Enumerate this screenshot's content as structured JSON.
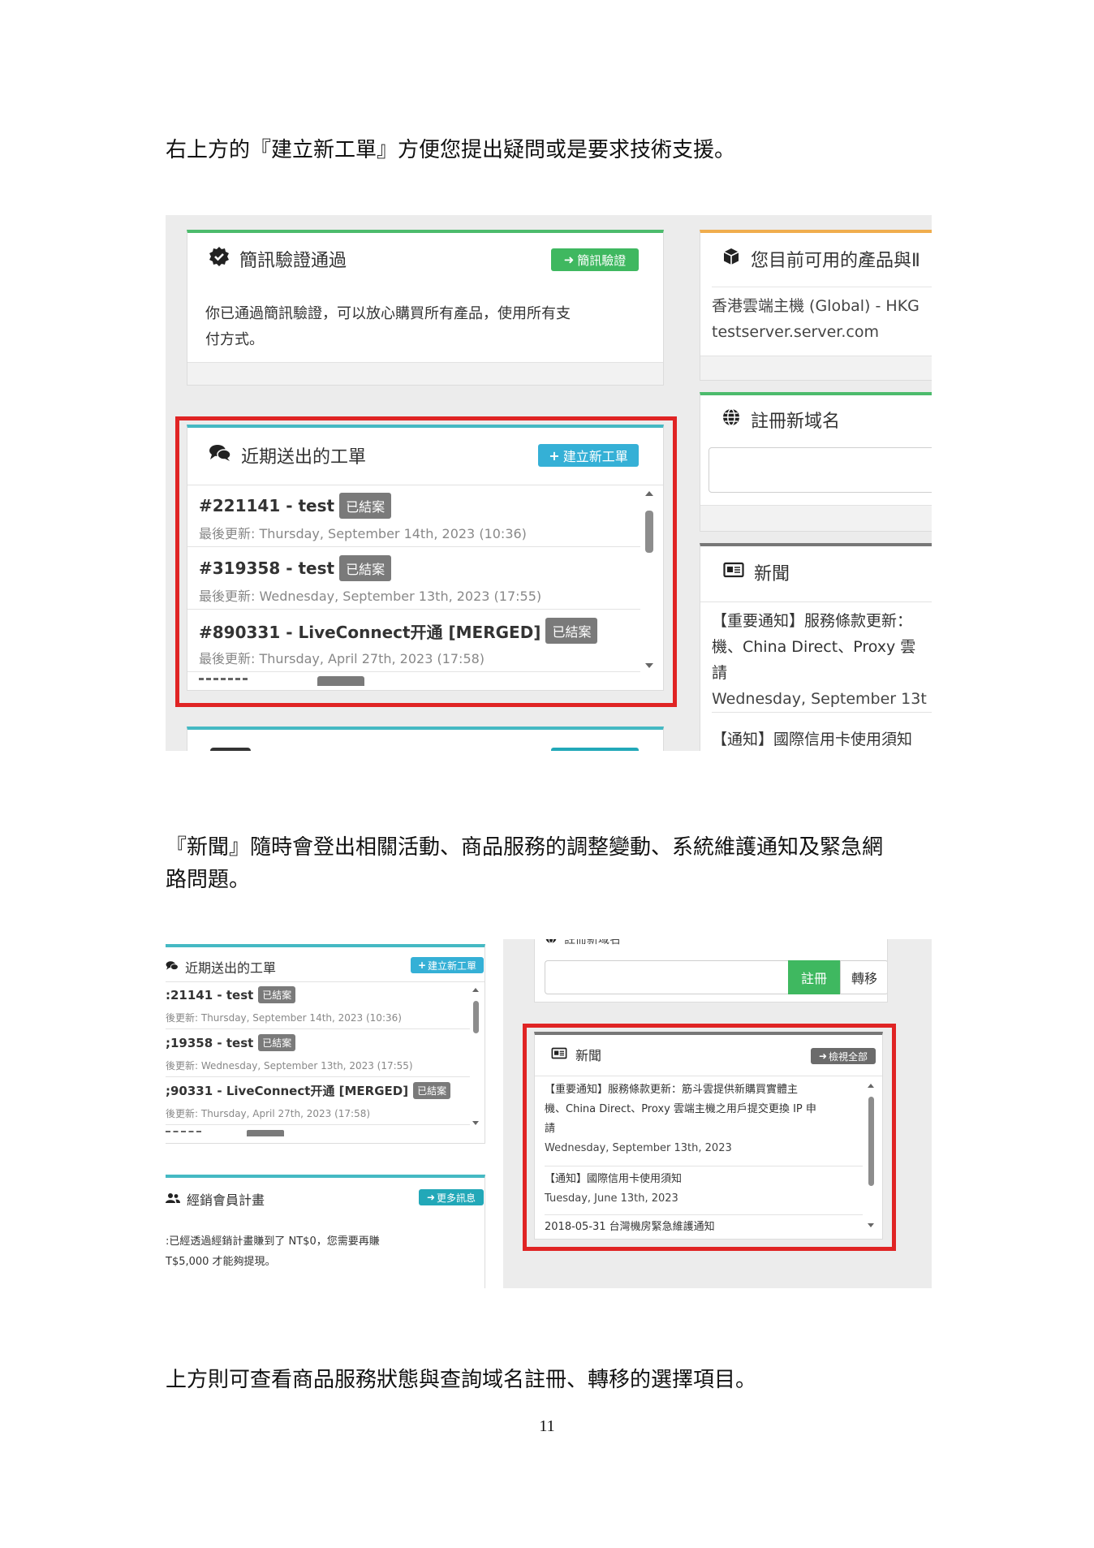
{
  "doc": {
    "para1": "右上方的『建立新工單』方便您提出疑問或是要求技術支援。",
    "para2": "『新聞』隨時會登出相關活動、商品服務的調整變動、系統維護通知及緊急網",
    "para2b": "路問題。",
    "para3": "上方則可查看商品服務狀態與查詢域名註冊、轉移的選擇項目。",
    "page_number": "11"
  },
  "shot1": {
    "sms": {
      "title": "簡訊驗證通過",
      "button": "簡訊驗證",
      "text_line1": "你已通過簡訊驗證，可以放心購買所有產品，使用所有支",
      "text_line2": "付方式。"
    },
    "products": {
      "title": "您目前可用的產品與Ⅱ",
      "line1": "香港雲端主機 (Global) - HKG",
      "line2": "testserver.server.com"
    },
    "domain": {
      "title": "註冊新域名"
    },
    "tickets": {
      "title": "近期送出的工單",
      "button": "建立新工單",
      "items": [
        {
          "title": "#221141 - test",
          "badge": "已結案",
          "sub": "最後更新: Thursday, September 14th, 2023 (10:36)"
        },
        {
          "title": "#319358 - test",
          "badge": "已結案",
          "sub": "最後更新: Wednesday, September 13th, 2023 (17:55)"
        },
        {
          "title": "#890331 - LiveConnect开通 [MERGED]",
          "badge": "已結案",
          "sub": "最後更新: Thursday, April 27th, 2023 (17:58)"
        }
      ]
    },
    "news": {
      "title": "新聞",
      "item1_line1": "【重要通知】服務條款更新：",
      "item1_line2": "機、China Direct、Proxy 雲",
      "item1_line3": "請",
      "item1_date": "Wednesday, September 13t",
      "item2_line1": "【通知】國際信用卡使用須知"
    }
  },
  "shot2": {
    "tickets": {
      "title": "近期送出的工單",
      "button": "建立新工單",
      "items": [
        {
          "title": ":21141 - test",
          "badge": "已結案",
          "sub": "後更新: Thursday, September 14th, 2023 (10:36)"
        },
        {
          "title": ";19358 - test",
          "badge": "已結案",
          "sub": "後更新: Wednesday, September 13th, 2023 (17:55)"
        },
        {
          "title": ";90331 - LiveConnect开通 [MERGED]",
          "badge": "已結案",
          "sub": "後更新: Thursday, April 27th, 2023 (17:58)"
        }
      ]
    },
    "affiliate": {
      "title": "經銷會員計畫",
      "button": "更多訊息",
      "line1": ":已經透過經銷計畫賺到了 NT$0，您需要再賺",
      "line2": "T$5,000 才能夠提現。"
    },
    "domain": {
      "title_partial": "註冊新域名",
      "register_button": "註冊",
      "transfer_button": "轉移"
    },
    "news": {
      "title": "新聞",
      "button": "檢視全部",
      "item1_line1": "【重要通知】服務條款更新：筋斗雲提供新購買實體主",
      "item1_line2": "機、China Direct、Proxy 雲端主機之用戶提交更換 IP 申",
      "item1_line3": "請",
      "item1_date": "Wednesday, September 13th, 2023",
      "item2_line1": "【通知】國際信用卡使用須知",
      "item2_date": "Tuesday, June 13th, 2023",
      "item3_line1": "2018-05-31 台灣機房緊急維護通知"
    }
  },
  "colors": {
    "highlight_red": "#e02424",
    "success_green": "#3fb860",
    "accent_teal": "#45b9c3",
    "badge_gray": "#7a7a7a"
  },
  "icons": {
    "sms": "badge-check-icon",
    "products": "cube-icon",
    "domain": "globe-icon",
    "tickets": "comments-icon",
    "news": "newspaper-icon",
    "affiliate": "users-icon",
    "arrow": "arrow-right-icon",
    "plus": "plus-icon"
  }
}
